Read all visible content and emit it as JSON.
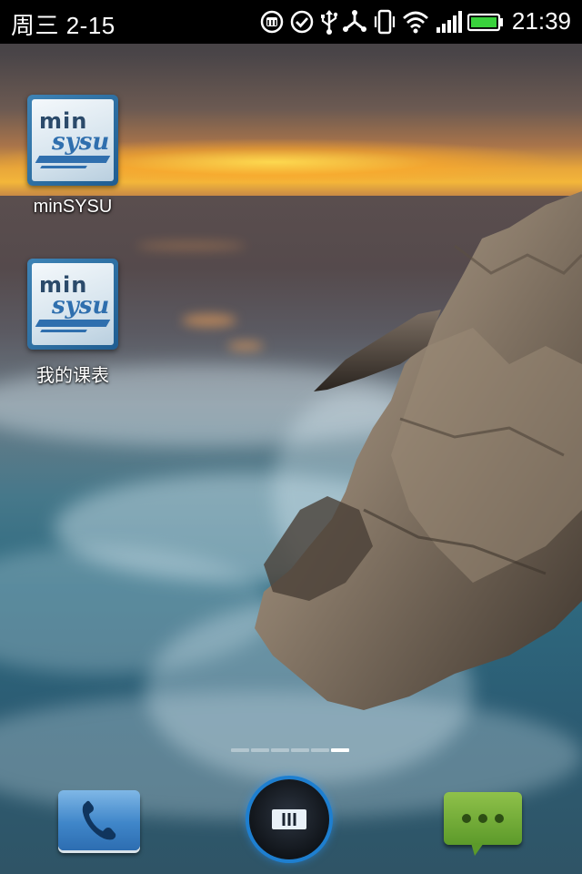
{
  "status_bar": {
    "date": "周三 2-15",
    "time": "21:39",
    "icons": [
      "m-notification-icon",
      "check-circle-icon",
      "usb-icon",
      "usb-debug-icon",
      "vibrate-icon",
      "wifi-icon",
      "signal-icon",
      "battery-icon"
    ]
  },
  "apps": [
    {
      "name": "minSYSU",
      "icon": "minsysu-logo-icon"
    },
    {
      "name": "我的课表",
      "icon": "minsysu-logo-icon"
    }
  ],
  "app_logo": {
    "line1": "min",
    "line2": "sysu"
  },
  "pager": {
    "pages": 6,
    "active": 6
  },
  "dock": {
    "left": "phone-icon",
    "center": "home-menu-icon",
    "right": "messages-icon"
  },
  "colors": {
    "statusbar": "#000000",
    "home_ring": "#1e7fd0",
    "phone": "#3f86c9",
    "messages": "#6aa734"
  }
}
